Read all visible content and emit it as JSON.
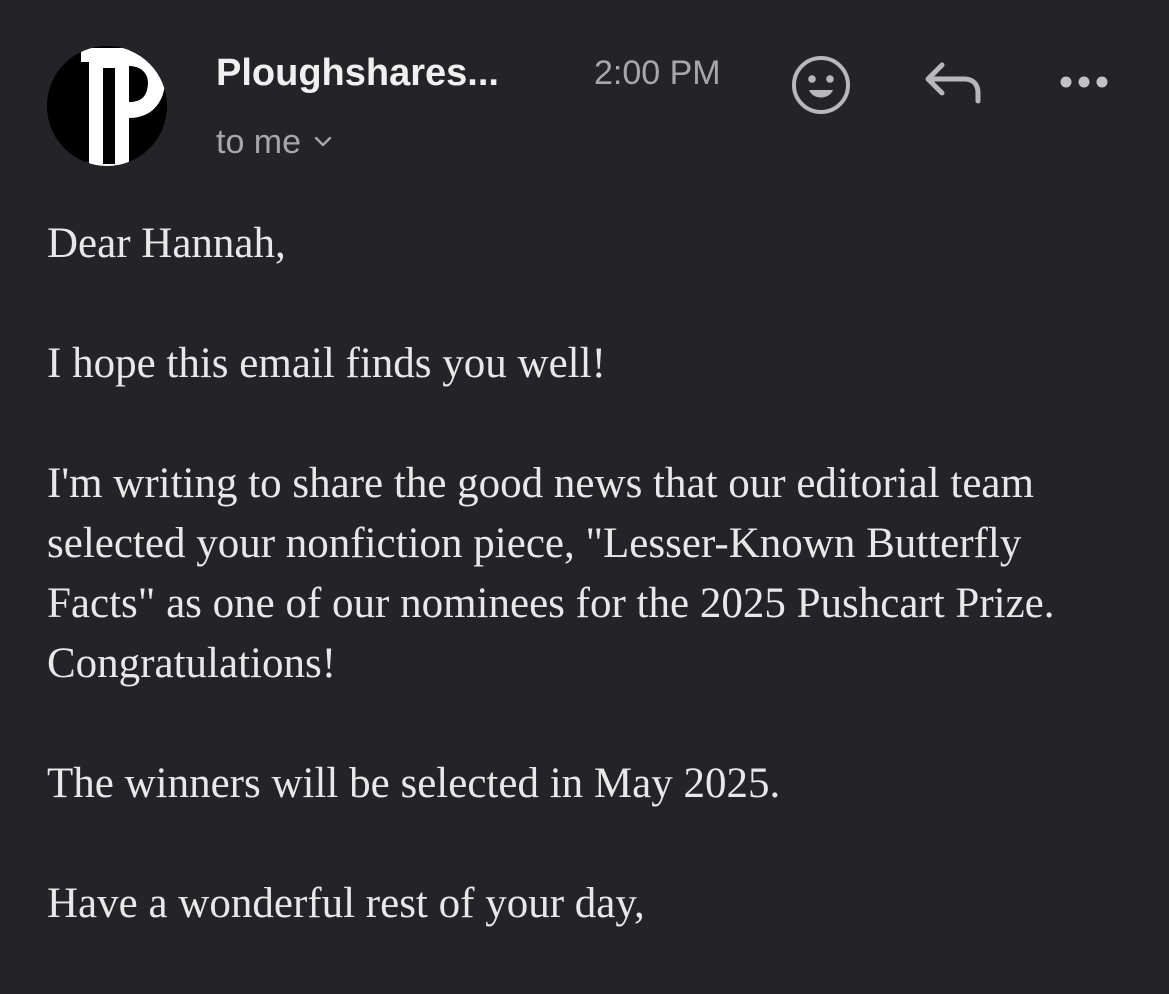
{
  "email": {
    "sender": "Ploughshares...",
    "time": "2:00 PM",
    "recipient_label": "to me",
    "avatar_letter": "P"
  },
  "icons": {
    "avatar": "ploughshares-logo",
    "reactions": "smiley-icon",
    "reply": "reply-arrow-icon",
    "more": "more-dots-icon",
    "recipient_toggle": "chevron-down-icon"
  },
  "colors": {
    "background": "#232328",
    "text": "#e8e8e8",
    "muted": "#a7a7ab"
  },
  "body": {
    "greeting": "Dear Hannah,",
    "line1": "I hope this email finds you well!",
    "paragraph1": "I'm writing to share the good news that our editorial team selected your nonfiction piece, \"Lesser-Known Butterfly Facts\" as one of our nominees for the 2025 Pushcart Prize. Congratulations!",
    "paragraph2": "The winners will be selected in May 2025.",
    "closing": "Have a wonderful rest of your day,"
  }
}
